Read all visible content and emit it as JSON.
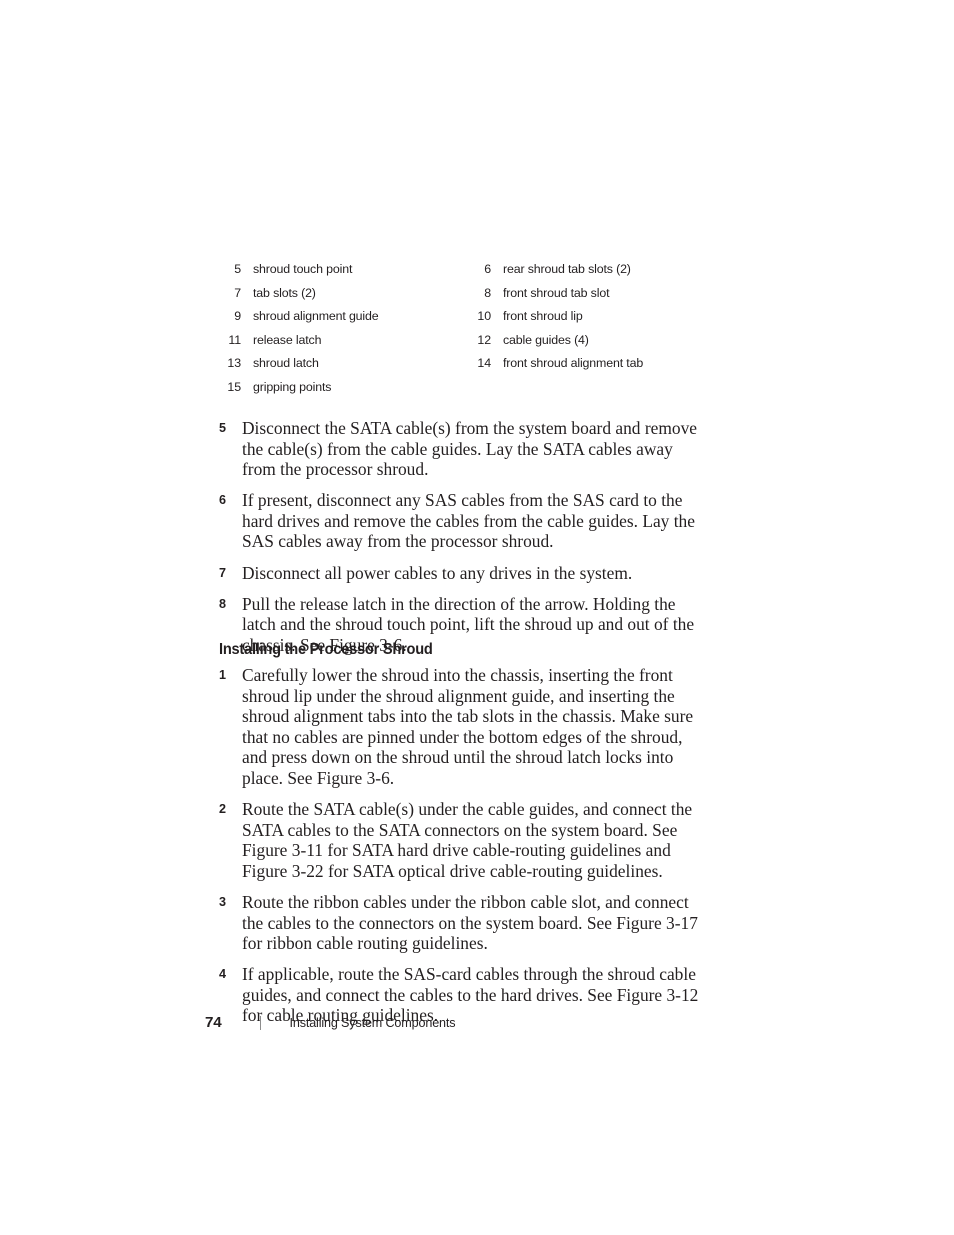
{
  "legend": {
    "rows": [
      {
        "left": {
          "num": "5",
          "label": "shroud touch point"
        },
        "right": {
          "num": "6",
          "label": "rear shroud tab slots (2)"
        }
      },
      {
        "left": {
          "num": "7",
          "label": "tab slots (2)"
        },
        "right": {
          "num": "8",
          "label": "front shroud tab slot"
        }
      },
      {
        "left": {
          "num": "9",
          "label": "shroud alignment guide"
        },
        "right": {
          "num": "10",
          "label": "front shroud lip"
        }
      },
      {
        "left": {
          "num": "11",
          "label": "release latch"
        },
        "right": {
          "num": "12",
          "label": "cable guides (4)"
        }
      },
      {
        "left": {
          "num": "13",
          "label": "shroud latch"
        },
        "right": {
          "num": "14",
          "label": "front shroud alignment tab"
        }
      },
      {
        "left": {
          "num": "15",
          "label": "gripping points"
        },
        "right": {
          "num": "",
          "label": ""
        }
      }
    ]
  },
  "removal_steps": [
    {
      "num": "5",
      "text": "Disconnect the SATA cable(s) from the system board and remove the cable(s) from the cable guides. Lay the SATA cables away from the processor shroud."
    },
    {
      "num": "6",
      "text": "If present, disconnect any SAS cables from the SAS card to the hard drives and remove the cables from the cable guides. Lay the SAS cables away from the processor shroud."
    },
    {
      "num": "7",
      "text": "Disconnect all power cables to any drives in the system."
    },
    {
      "num": "8",
      "text": "Pull the release latch in the direction of the arrow. Holding the latch and the shroud touch point, lift the shroud up and out of the chassis. See Figure 3-6."
    }
  ],
  "section": {
    "heading": "Installing the Processor Shroud"
  },
  "install_steps": [
    {
      "num": "1",
      "text": "Carefully lower the shroud into the chassis, inserting the front shroud lip under the shroud alignment guide, and inserting the shroud alignment tabs into the tab slots in the chassis. Make sure that no cables are pinned under the bottom edges of the shroud, and press down on the shroud until the shroud latch locks into place. See Figure 3-6."
    },
    {
      "num": "2",
      "text": "Route the SATA cable(s) under the cable guides, and connect the SATA cables to the SATA connectors on the system board. See Figure 3-11 for SATA hard drive cable-routing guidelines and Figure 3-22 for SATA optical drive cable-routing guidelines."
    },
    {
      "num": "3",
      "text": "Route the ribbon cables under the ribbon cable slot, and connect the cables to the connectors on the system board. See Figure 3-17 for ribbon cable routing guidelines."
    },
    {
      "num": "4",
      "text": "If applicable, route the SAS-card cables through the shroud cable guides, and connect the cables to the hard drives. See Figure 3-12 for cable routing guidelines."
    }
  ],
  "footer": {
    "page_number": "74",
    "title": "Installing System Components"
  }
}
